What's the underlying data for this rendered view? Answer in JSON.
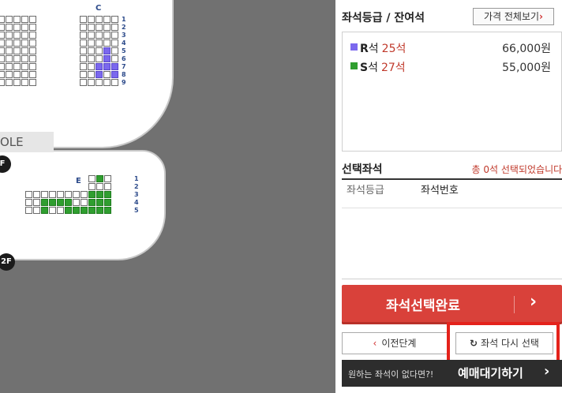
{
  "seatmap": {
    "upper": {
      "section_label": "C",
      "rows": [
        "1",
        "2",
        "3",
        "4",
        "5",
        "6",
        "7",
        "8",
        "9"
      ],
      "left_block_cols": 5,
      "right_block": [
        "wwwww",
        "wwwww",
        "wwwww",
        "wwwww",
        "wwwrw",
        "wwwrw",
        "wwrrr",
        "wwrwr",
        "wwwww"
      ]
    },
    "console_label": "OLE",
    "lower": {
      "section_label": "E",
      "rows": [
        "1",
        "2",
        "3",
        "4",
        "5"
      ],
      "block": [
        "........wsw",
        "........www",
        "wwwwwwwwsss",
        "wwsssswwsss",
        "wwswwssssss"
      ]
    },
    "floor_labels": [
      "F",
      "2F"
    ]
  },
  "panel": {
    "title": "좌석등급 / 잔여석",
    "price_button": "가격 전체보기",
    "grades": [
      {
        "name": "R",
        "suffix": "석",
        "count": "25석",
        "price": "66,000원",
        "color": "#7b68ee"
      },
      {
        "name": "S",
        "suffix": "석",
        "count": "27석",
        "price": "55,000원",
        "color": "#2f9e2f"
      }
    ],
    "selected": {
      "title": "선택좌석",
      "count_text": "총 0석 선택되었습니다.",
      "col_grade": "좌석등급",
      "col_number": "좌석번호"
    },
    "complete_button": "좌석선택완료",
    "prev_button": "이전단계",
    "reset_button": "좌석 다시 선택",
    "waitlist_prompt": "원하는 좌석이 없다면?!",
    "waitlist_button": "예매대기하기"
  },
  "colors": {
    "accent_red": "#d9413a",
    "highlight": "#e4221b",
    "r_seat": "#7b68ee",
    "s_seat": "#2f9e2f"
  }
}
